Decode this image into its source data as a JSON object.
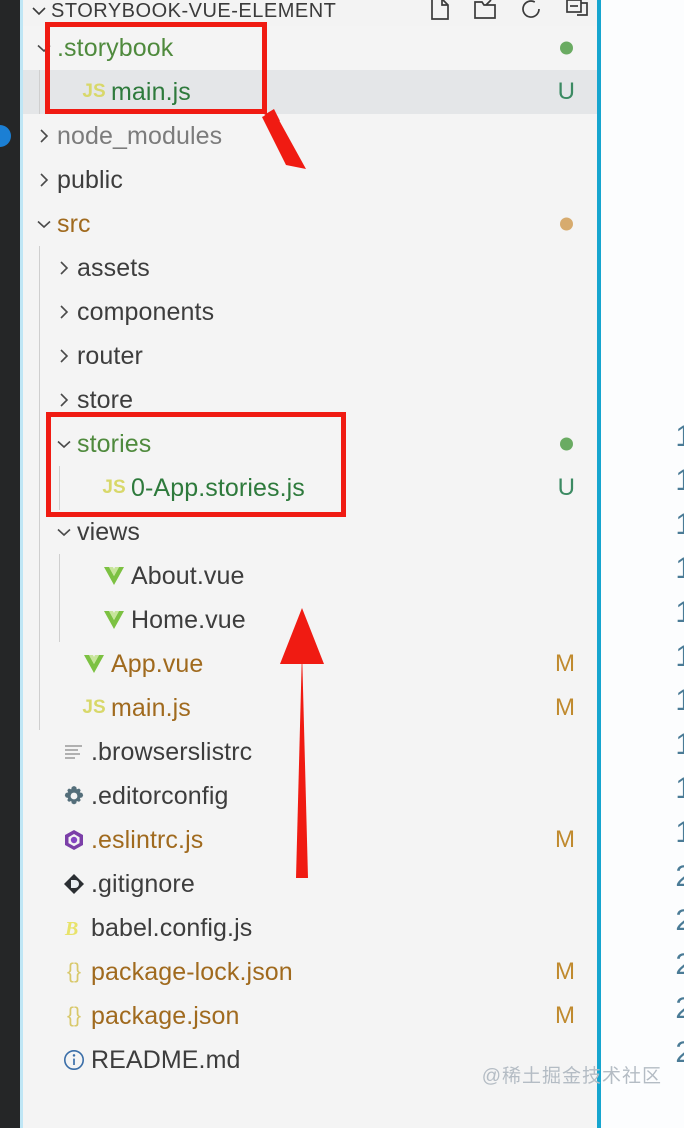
{
  "window": {
    "explorer_title": "STORYBOOK-VUE-ELEMENT",
    "title_twisty": "chevron-down"
  },
  "toolbar": {
    "actions": [
      {
        "name": "new-file-icon",
        "label": "New File"
      },
      {
        "name": "new-folder-icon",
        "label": "New Folder"
      },
      {
        "name": "refresh-icon",
        "label": "Refresh Explorer"
      },
      {
        "name": "collapse-all-icon",
        "label": "Collapse Folders in Explorer"
      }
    ]
  },
  "tree": {
    "rows": [
      {
        "label": ".storybook",
        "kind": "folder",
        "expanded": true,
        "depth": 0,
        "icon": "none",
        "status": "",
        "dot": "green",
        "label_color": "folder-green",
        "selected": false
      },
      {
        "label": "main.js",
        "kind": "file",
        "expanded": null,
        "depth": 1,
        "icon": "js",
        "status": "U",
        "dot": "",
        "label_color": "green-file",
        "selected": true
      },
      {
        "label": "node_modules",
        "kind": "folder",
        "expanded": false,
        "depth": 0,
        "icon": "none",
        "status": "",
        "dot": "",
        "label_color": "folder-dim",
        "selected": false
      },
      {
        "label": "public",
        "kind": "folder",
        "expanded": false,
        "depth": 0,
        "icon": "none",
        "status": "",
        "dot": "",
        "label_color": "dark",
        "selected": false
      },
      {
        "label": "src",
        "kind": "folder",
        "expanded": true,
        "depth": 0,
        "icon": "none",
        "status": "",
        "dot": "tan",
        "label_color": "orange",
        "selected": false
      },
      {
        "label": "assets",
        "kind": "folder",
        "expanded": false,
        "depth": 1,
        "icon": "none",
        "status": "",
        "dot": "",
        "label_color": "dark",
        "selected": false
      },
      {
        "label": "components",
        "kind": "folder",
        "expanded": false,
        "depth": 1,
        "icon": "none",
        "status": "",
        "dot": "",
        "label_color": "dark",
        "selected": false
      },
      {
        "label": "router",
        "kind": "folder",
        "expanded": false,
        "depth": 1,
        "icon": "none",
        "status": "",
        "dot": "",
        "label_color": "dark",
        "selected": false
      },
      {
        "label": "store",
        "kind": "folder",
        "expanded": false,
        "depth": 1,
        "icon": "none",
        "status": "",
        "dot": "",
        "label_color": "dark",
        "selected": false
      },
      {
        "label": "stories",
        "kind": "folder",
        "expanded": true,
        "depth": 1,
        "icon": "none",
        "status": "",
        "dot": "green",
        "label_color": "folder-green",
        "selected": false
      },
      {
        "label": "0-App.stories.js",
        "kind": "file",
        "expanded": null,
        "depth": 2,
        "icon": "js",
        "status": "U",
        "dot": "",
        "label_color": "green-file",
        "selected": false
      },
      {
        "label": "views",
        "kind": "folder",
        "expanded": true,
        "depth": 1,
        "icon": "none",
        "status": "",
        "dot": "",
        "label_color": "dark",
        "selected": false
      },
      {
        "label": "About.vue",
        "kind": "file",
        "expanded": null,
        "depth": 2,
        "icon": "vue",
        "status": "",
        "dot": "",
        "label_color": "dark",
        "selected": false
      },
      {
        "label": "Home.vue",
        "kind": "file",
        "expanded": null,
        "depth": 2,
        "icon": "vue",
        "status": "",
        "dot": "",
        "label_color": "dark",
        "selected": false
      },
      {
        "label": "App.vue",
        "kind": "file",
        "expanded": null,
        "depth": 1,
        "icon": "vue",
        "status": "M",
        "dot": "",
        "label_color": "orange",
        "selected": false
      },
      {
        "label": "main.js",
        "kind": "file",
        "expanded": null,
        "depth": 1,
        "icon": "js",
        "status": "M",
        "dot": "",
        "label_color": "orange",
        "selected": false
      },
      {
        "label": ".browserslistrc",
        "kind": "file",
        "expanded": null,
        "depth": 0,
        "icon": "list",
        "status": "",
        "dot": "",
        "label_color": "dark",
        "selected": false
      },
      {
        "label": ".editorconfig",
        "kind": "file",
        "expanded": null,
        "depth": 0,
        "icon": "gear",
        "status": "",
        "dot": "",
        "label_color": "dark",
        "selected": false
      },
      {
        "label": ".eslintrc.js",
        "kind": "file",
        "expanded": null,
        "depth": 0,
        "icon": "eslint",
        "status": "M",
        "dot": "",
        "label_color": "orange",
        "selected": false
      },
      {
        "label": ".gitignore",
        "kind": "file",
        "expanded": null,
        "depth": 0,
        "icon": "git",
        "status": "",
        "dot": "",
        "label_color": "dark",
        "selected": false
      },
      {
        "label": "babel.config.js",
        "kind": "file",
        "expanded": null,
        "depth": 0,
        "icon": "babel",
        "status": "",
        "dot": "",
        "label_color": "dark",
        "selected": false
      },
      {
        "label": "package-lock.json",
        "kind": "file",
        "expanded": null,
        "depth": 0,
        "icon": "json",
        "status": "M",
        "dot": "",
        "label_color": "orange",
        "selected": false
      },
      {
        "label": "package.json",
        "kind": "file",
        "expanded": null,
        "depth": 0,
        "icon": "json",
        "status": "M",
        "dot": "",
        "label_color": "orange",
        "selected": false
      },
      {
        "label": "README.md",
        "kind": "file",
        "expanded": null,
        "depth": 0,
        "icon": "info",
        "status": "",
        "dot": "",
        "label_color": "dark",
        "selected": false
      }
    ]
  },
  "editor": {
    "line_numbers": [
      "1",
      "1",
      "1",
      "1",
      "1",
      "1",
      "1",
      "1",
      "1",
      "1",
      "2",
      "2",
      "2",
      "2",
      "2"
    ]
  },
  "annotations": {
    "boxes": [
      {
        "name": "storybook-folder-highlight",
        "target": ".storybook / main.js"
      },
      {
        "name": "stories-folder-highlight",
        "target": "stories / 0-App.stories.js"
      }
    ],
    "arrows": [
      {
        "name": "arrow-to-storybook",
        "points_to": ".storybook"
      },
      {
        "name": "arrow-to-stories",
        "points_to": "stories"
      }
    ],
    "color": "#f01b12"
  },
  "watermark": {
    "text": "@稀土掘金技术社区"
  }
}
